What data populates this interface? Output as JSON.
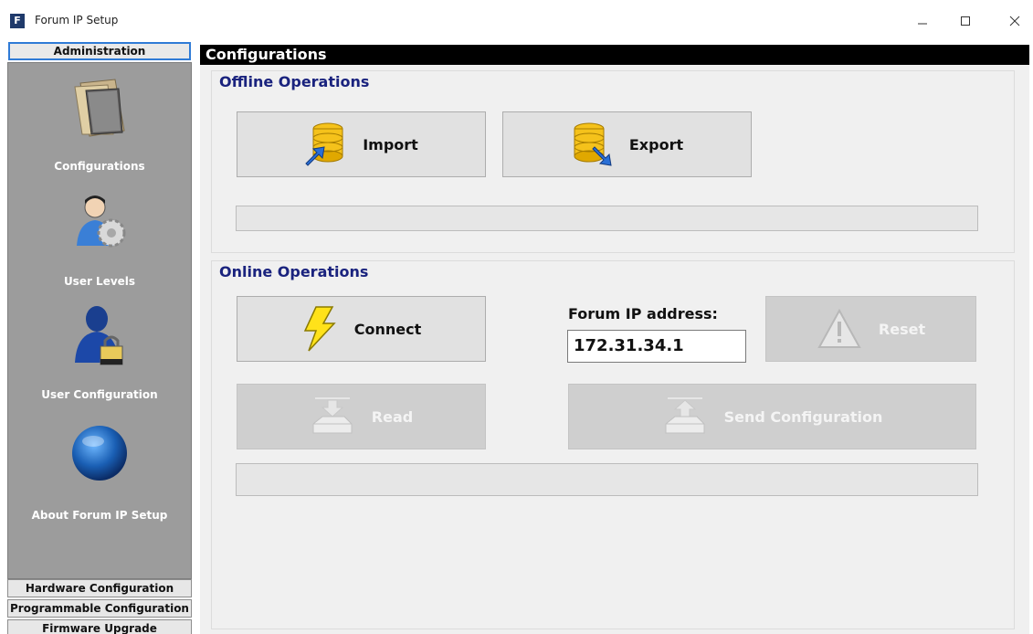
{
  "window": {
    "app_icon_letter": "F",
    "title": "Forum IP Setup"
  },
  "sidebar": {
    "header": "Administration",
    "items": [
      {
        "label": "Configurations",
        "icon": "folder-icon"
      },
      {
        "label": "User Levels",
        "icon": "user-gear-icon"
      },
      {
        "label": "User Configuration",
        "icon": "user-lock-icon"
      },
      {
        "label": "About Forum IP Setup",
        "icon": "globe-icon"
      }
    ],
    "tabs": [
      "Hardware Configuration",
      "Programmable Configuration",
      "Firmware Upgrade"
    ]
  },
  "main": {
    "title": "Configurations",
    "offline": {
      "title": "Offline Operations",
      "import_label": "Import",
      "export_label": "Export",
      "progress": 0
    },
    "online": {
      "title": "Online Operations",
      "connect_label": "Connect",
      "ip_label": "Forum IP address:",
      "ip_value": "172.31.34.1",
      "reset_label": "Reset",
      "read_label": "Read",
      "send_label": "Send Configuration",
      "progress": 0
    }
  },
  "colors": {
    "sidebar_bg": "#9c9c9c",
    "group_title": "#1a237e",
    "header_bg": "#000000",
    "selected_border": "#2f7bd6"
  }
}
